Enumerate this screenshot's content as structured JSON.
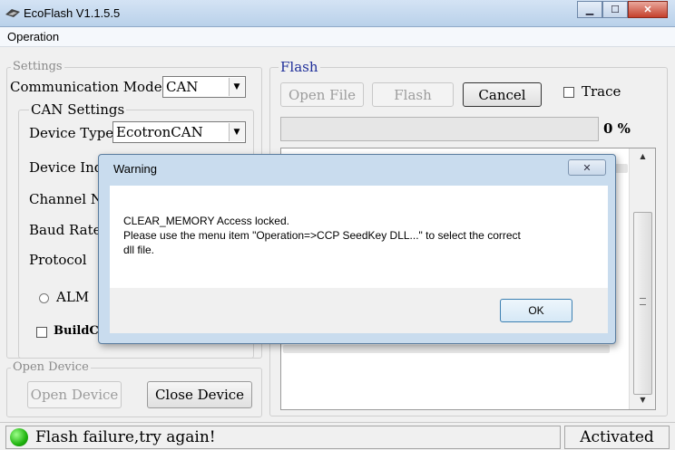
{
  "window": {
    "title": "EcoFlash V1.1.5.5"
  },
  "menu": {
    "operation": "Operation"
  },
  "settings": {
    "legend": "Settings",
    "comm_mode_label": "Communication Mode",
    "comm_mode_value": "CAN",
    "can_settings_legend": "CAN Settings",
    "device_type_label": "Device Type",
    "device_type_value": "EcotronCAN",
    "device_index_label": "Device Inde",
    "channel_label": "Channel No",
    "baud_rate_label": "Baud Rate",
    "protocol_label": "Protocol",
    "alm_label": "ALM",
    "buildch_label": "BuildCh"
  },
  "open_device": {
    "legend": "Open Device",
    "open_button": "Open Device",
    "close_button": "Close Device"
  },
  "flash": {
    "legend": "Flash",
    "open_file_button": "Open File",
    "flash_button": "Flash",
    "cancel_button": "Cancel",
    "trace_label": "Trace",
    "progress_text": "0 %",
    "progress_fraction": 0
  },
  "dialog": {
    "title": "Warning",
    "line1": "CLEAR_MEMORY Access locked.",
    "line2": "Please use the menu item \"Operation=>CCP SeedKey DLL...\" to select the correct",
    "line3": "dll file.",
    "ok_button": "OK"
  },
  "status": {
    "message": "Flash failure,try again!",
    "activation": "Activated"
  }
}
